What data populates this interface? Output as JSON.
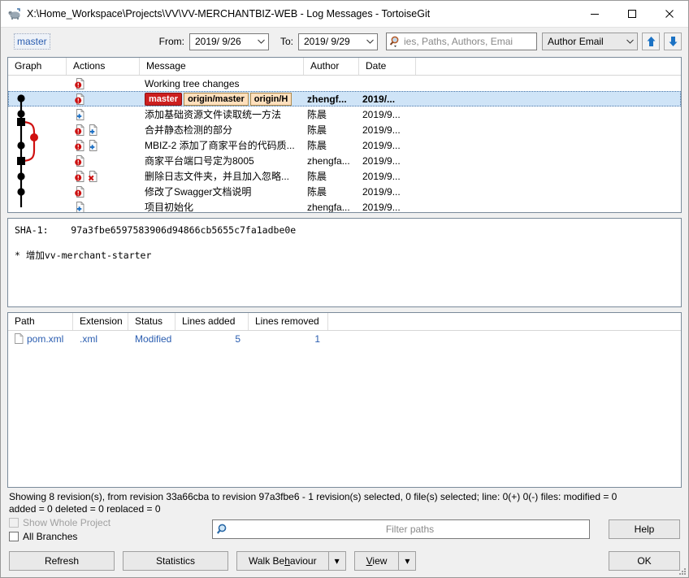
{
  "window": {
    "title": "X:\\Home_Workspace\\Projects\\VV\\VV-MERCHANTBIZ-WEB - Log Messages - TortoiseGit",
    "minimize": "—",
    "maximize": "☐",
    "close": "✕"
  },
  "filterbar": {
    "branch": "master",
    "from_label": "From:",
    "from_value": "2019/ 9/26",
    "to_label": "To:",
    "to_value": "2019/ 9/29",
    "search_placeholder": "ies, Paths, Authors, Emai",
    "scope_value": "Author Email",
    "up_arrow": "⬆",
    "down_arrow": "⬇"
  },
  "log": {
    "columns": [
      "Graph",
      "Actions",
      "Message",
      "Author",
      "Date"
    ],
    "rows": [
      {
        "graph": "none",
        "actions": [
          "modified"
        ],
        "message": "Working tree changes",
        "author": "",
        "date": "",
        "selected": false,
        "refs": []
      },
      {
        "graph": "dot",
        "actions": [
          "modified"
        ],
        "message": "",
        "author": "zhengf...",
        "date": "2019/...",
        "selected": true,
        "refs": [
          {
            "text": "master",
            "kind": "local"
          },
          {
            "text": "origin/master",
            "kind": "remote"
          },
          {
            "text": "origin/H",
            "kind": "clipped"
          }
        ]
      },
      {
        "graph": "dot",
        "actions": [
          "added"
        ],
        "message": "添加基础资源文件读取统一方法",
        "author": "陈晨",
        "date": "2019/9...",
        "selected": false,
        "refs": []
      },
      {
        "graph": "merge-top",
        "actions": [
          "modified",
          "added"
        ],
        "message": "合并静态检测的部分",
        "author": "陈晨",
        "date": "2019/9...",
        "selected": false,
        "refs": []
      },
      {
        "graph": "branch-dot",
        "actions": [
          "modified",
          "added"
        ],
        "message": "MBIZ-2 添加了商家平台的代码质...",
        "author": "陈晨",
        "date": "2019/9...",
        "selected": false,
        "refs": []
      },
      {
        "graph": "dot",
        "actions": [
          "modified"
        ],
        "message": "商家平台端口号定为8005",
        "author": "zhengfa...",
        "date": "2019/9...",
        "selected": false,
        "refs": []
      },
      {
        "graph": "merge-bottom",
        "actions": [
          "modified",
          "deleted"
        ],
        "message": "删除日志文件夹，并且加入忽略...",
        "author": "陈晨",
        "date": "2019/9...",
        "selected": false,
        "refs": []
      },
      {
        "graph": "dot",
        "actions": [
          "modified"
        ],
        "message": "修改了Swagger文档说明",
        "author": "陈晨",
        "date": "2019/9...",
        "selected": false,
        "refs": []
      },
      {
        "graph": "dot-end",
        "actions": [
          "added"
        ],
        "message": "项目初始化",
        "author": "zhengfa...",
        "date": "2019/9...",
        "selected": false,
        "refs": []
      }
    ]
  },
  "detail": {
    "sha_label": "SHA-1:",
    "sha_value": "97a3fbe6597583906d94866cb5655c7fa1adbe0e",
    "message": "* 增加vv-merchant-starter"
  },
  "files": {
    "columns": [
      "Path",
      "Extension",
      "Status",
      "Lines added",
      "Lines removed"
    ],
    "rows": [
      {
        "path": "pom.xml",
        "extension": ".xml",
        "status": "Modified",
        "added": "5",
        "removed": "1"
      }
    ]
  },
  "status": {
    "line1": "Showing 8 revision(s), from revision 33a66cba to revision 97a3fbe6 - 1 revision(s) selected, 0 file(s) selected; line: 0(+) 0(-) files: modified = 0",
    "line2": "added = 0 deleted = 0 replaced = 0"
  },
  "bottom": {
    "show_whole_project": "Show Whole Project",
    "all_branches": "All Branches",
    "filter_paths_placeholder": "Filter paths",
    "help": "Help",
    "refresh": "Refresh",
    "statistics": "Statistics",
    "walk_behaviour": "Walk Behaviour",
    "view": "View",
    "ok": "OK",
    "dropdown_arrow": "▾"
  },
  "colors": {
    "accent": "#2a5db0",
    "ref_local_bg": "#cc1f1f",
    "ref_remote_bg": "#ffe0bd",
    "selection": "#cfe4f7",
    "branch_line": "#d01010"
  }
}
